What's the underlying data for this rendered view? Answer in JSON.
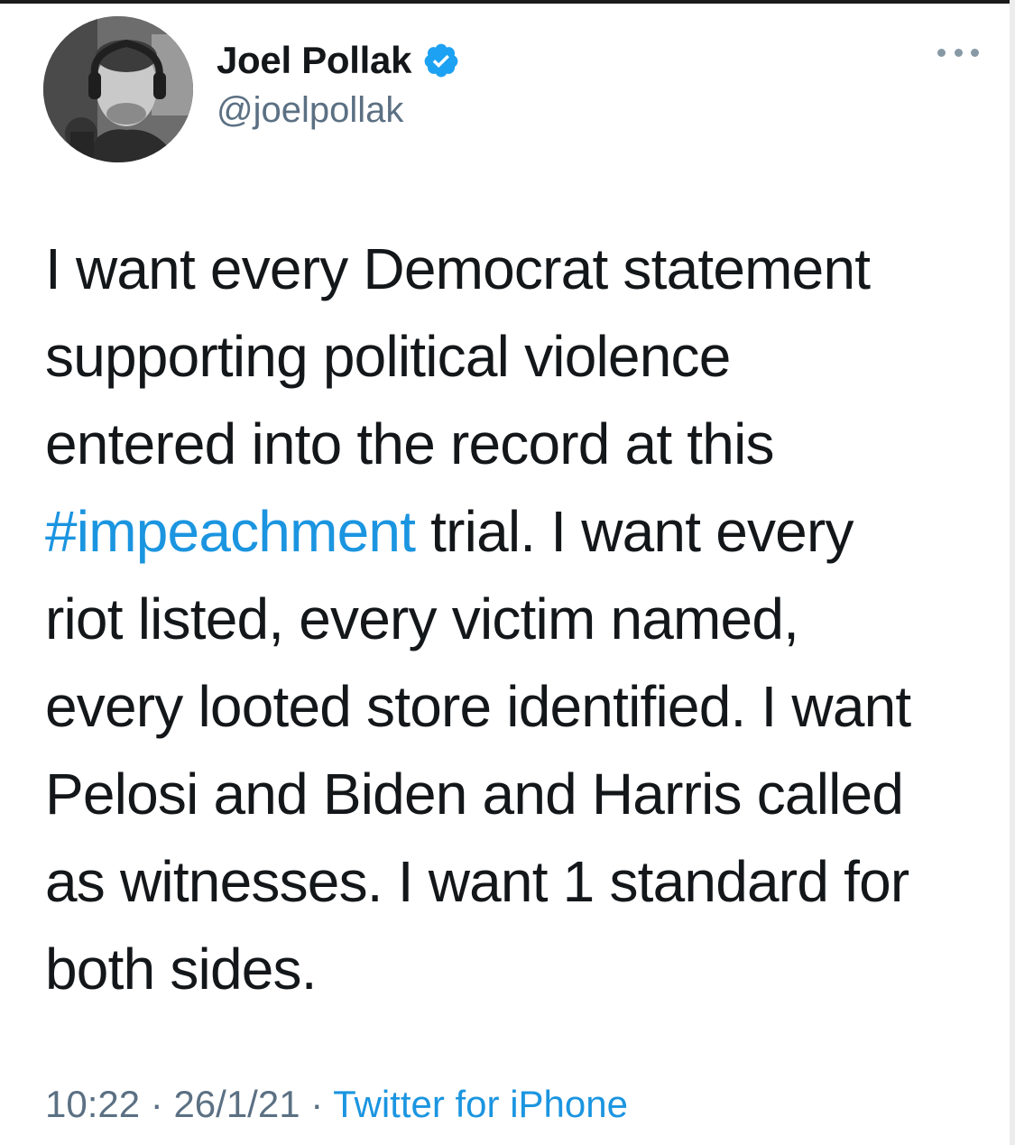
{
  "user": {
    "display_name": "Joel Pollak",
    "handle": "@joelpollak",
    "verified": true
  },
  "icons": {
    "verified": "verified-badge-icon",
    "more": "more-options-icon"
  },
  "tweet": {
    "lines": [
      {
        "text": "I want every Democrat statement"
      },
      {
        "text": "supporting political violence"
      },
      {
        "text": "entered into the record at this"
      },
      {
        "hashtag": "#impeachment",
        "text": " trial. I want every"
      },
      {
        "text": "riot listed, every victim named,"
      },
      {
        "text": "every looted store identified. I want"
      },
      {
        "text": "Pelosi and Biden and Harris called"
      },
      {
        "text": "as witnesses. I want 1 standard for"
      },
      {
        "text": "both sides."
      }
    ]
  },
  "meta": {
    "time": "10:22",
    "separator": " · ",
    "date": "26/1/21",
    "source": "Twitter for iPhone"
  },
  "colors": {
    "text": "#14171a",
    "secondary": "#5b7083",
    "link": "#1b95e0",
    "verified": "#1da1f2"
  }
}
